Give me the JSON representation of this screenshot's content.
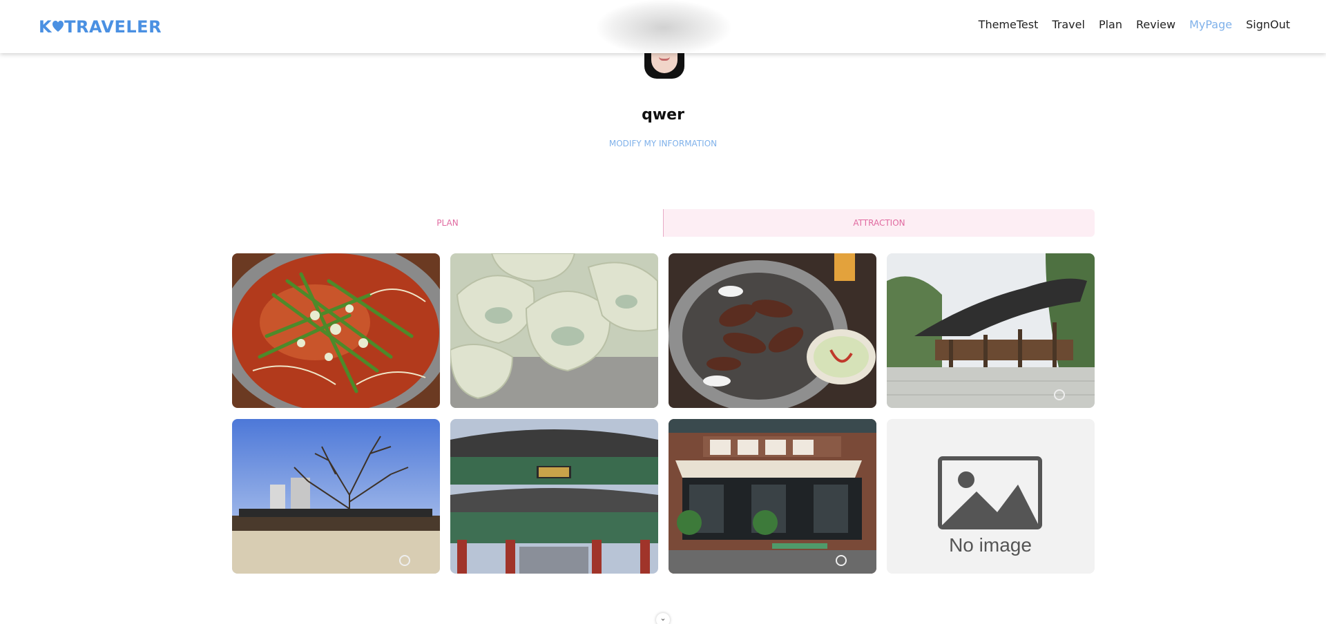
{
  "header": {
    "logo_text": "TRAVELER",
    "logo_prefix": "K",
    "nav": [
      {
        "label": "ThemeTest",
        "active": false
      },
      {
        "label": "Travel",
        "active": false
      },
      {
        "label": "Plan",
        "active": false
      },
      {
        "label": "Review",
        "active": false
      },
      {
        "label": "MyPage",
        "active": true
      },
      {
        "label": "SignOut",
        "active": false
      }
    ]
  },
  "profile": {
    "username": "qwer",
    "modify_label": "MODIFY MY INFORMATION"
  },
  "tabs": [
    {
      "label": "PLAN",
      "active": false
    },
    {
      "label": "ATTRACTION",
      "active": true
    }
  ],
  "cards": [
    {
      "image": "spicy-noodle-soup-photo"
    },
    {
      "image": "steamed-dumplings-photo"
    },
    {
      "image": "grilled-meat-photo"
    },
    {
      "image": "traditional-pavilion-photo"
    },
    {
      "image": "bare-tree-courtyard-photo"
    },
    {
      "image": "palace-gate-photo"
    },
    {
      "image": "restaurant-storefront-photo"
    },
    {
      "image": "no-image-placeholder",
      "placeholder_text": "No image"
    }
  ],
  "colors": {
    "brand": "#4a90e2",
    "nav_active": "#7fb1ea",
    "tab_accent": "#e06aa0",
    "tab_active_bg": "#fdeef4"
  }
}
